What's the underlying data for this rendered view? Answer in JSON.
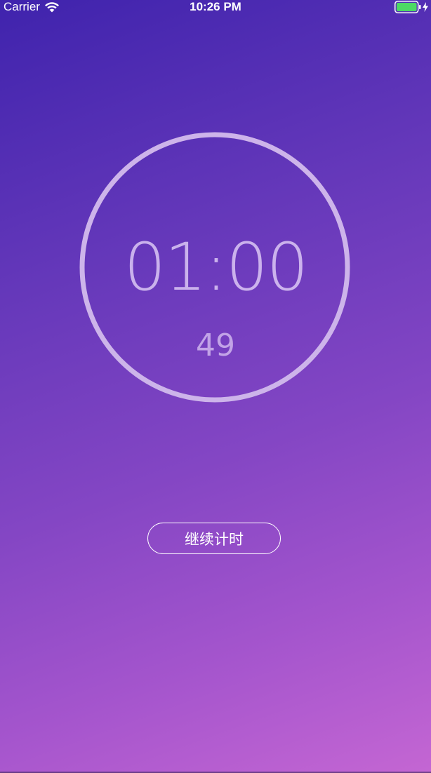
{
  "status_bar": {
    "carrier": "Carrier",
    "time": "10:26 PM",
    "battery_color": "#4cd964"
  },
  "timer": {
    "main_time": "01:00",
    "sub_seconds": "49"
  },
  "controls": {
    "resume_label": "继续计时"
  },
  "colors": {
    "gradient_start": "#3f23ad",
    "gradient_end": "#c466d3",
    "ring": "#cdb4ea"
  }
}
